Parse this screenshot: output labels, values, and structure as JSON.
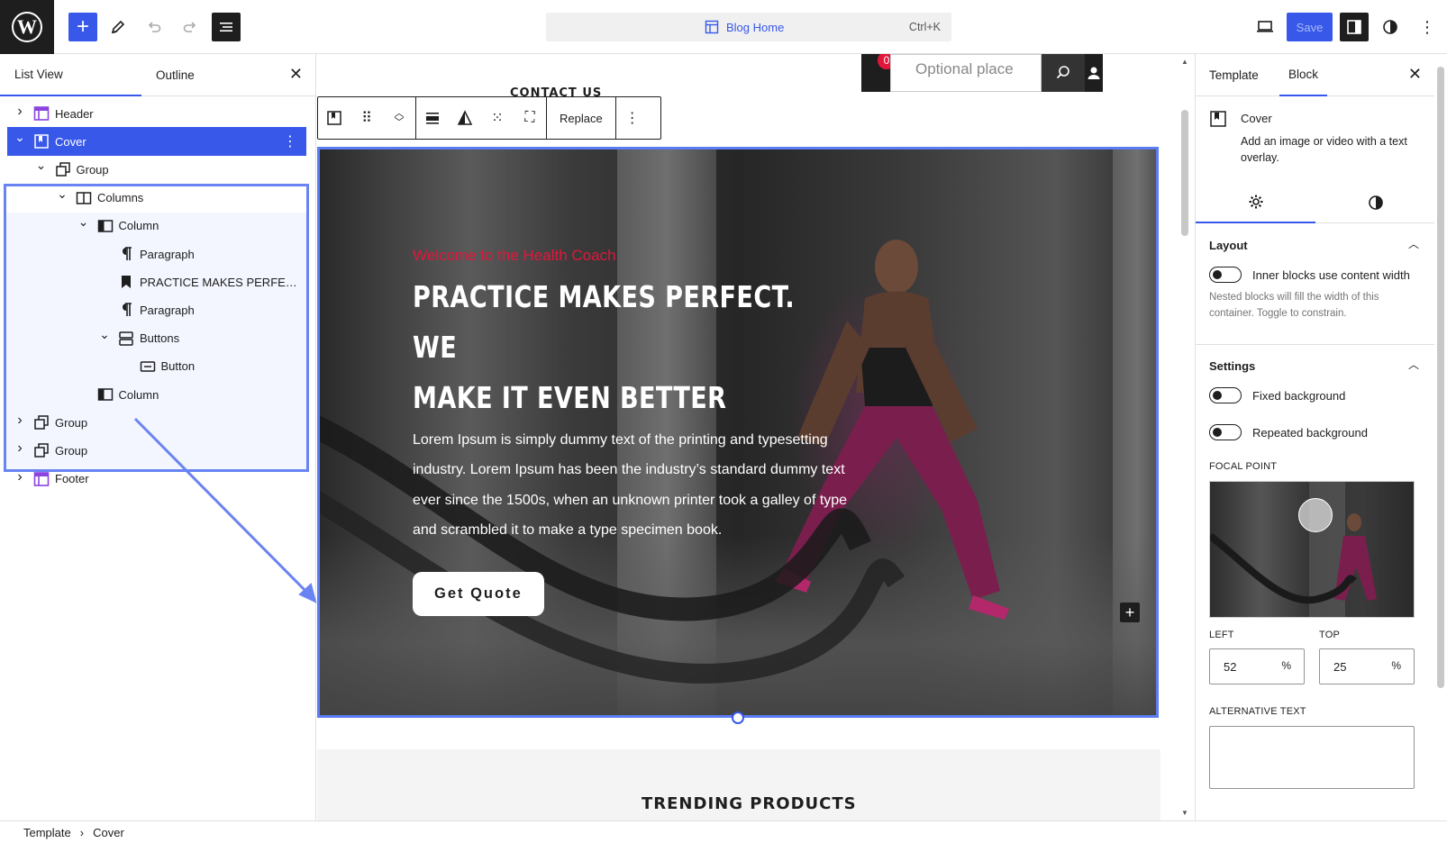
{
  "topbar": {
    "logo": "W",
    "document_title": "Blog Home",
    "shortcut": "Ctrl+K",
    "save_label": "Save",
    "more_icon": "⋮"
  },
  "list_view": {
    "tabs": [
      "List View",
      "Outline"
    ],
    "items": [
      {
        "label": "Header",
        "icon": "template-part-icon",
        "depth": 0,
        "expanded": false
      },
      {
        "label": "Cover",
        "icon": "cover-icon",
        "depth": 0,
        "expanded": true,
        "selected": true
      },
      {
        "label": "Group",
        "icon": "group-icon",
        "depth": 1,
        "expanded": true
      },
      {
        "label": "Columns",
        "icon": "columns-icon",
        "depth": 2,
        "expanded": true
      },
      {
        "label": "Column",
        "icon": "column-icon",
        "depth": 3,
        "expanded": true
      },
      {
        "label": "Paragraph",
        "icon": "paragraph-icon",
        "depth": 4
      },
      {
        "label": "PRACTICE MAKES PERFE…",
        "icon": "heading-bookmark-icon",
        "depth": 4
      },
      {
        "label": "Paragraph",
        "icon": "paragraph-icon",
        "depth": 4
      },
      {
        "label": "Buttons",
        "icon": "buttons-icon",
        "depth": 4,
        "expanded": true
      },
      {
        "label": "Button",
        "icon": "button-icon",
        "depth": 5
      },
      {
        "label": "Column",
        "icon": "column-icon",
        "depth": 3
      },
      {
        "label": "Group",
        "icon": "group-icon",
        "depth": 0,
        "expanded": false
      },
      {
        "label": "Group",
        "icon": "group-icon",
        "depth": 0,
        "expanded": false
      },
      {
        "label": "Footer",
        "icon": "template-part-icon",
        "depth": 0,
        "expanded": false
      }
    ]
  },
  "canvas": {
    "nav_link": "CONTACT US",
    "cart_count": "0",
    "search_placeholder": "Optional place",
    "toolbar_replace": "Replace",
    "cover": {
      "welcome": "Welcome to the Health Coach",
      "headline_line1": "PRACTICE MAKES PERFECT. WE",
      "headline_line2": "MAKE IT EVEN BETTER",
      "body": "Lorem Ipsum is simply dummy text of the printing and typesetting industry. Lorem Ipsum has been the industry’s standard dummy text ever since the 1500s, when an unknown printer took a galley of type and scrambled it to make a type specimen book.",
      "button": "Get Quote"
    },
    "next_section_title": "TRENDING PRODUCTS"
  },
  "settings_panel": {
    "tabs": [
      "Template",
      "Block"
    ],
    "block_name": "Cover",
    "block_description": "Add an image or video with a text overlay.",
    "layout": {
      "title": "Layout",
      "toggle_label": "Inner blocks use content width",
      "help": "Nested blocks will fill the width of this container. Toggle to constrain."
    },
    "settings": {
      "title": "Settings",
      "fixed_bg": "Fixed background",
      "repeated_bg": "Repeated background",
      "focal_point_label": "FOCAL POINT",
      "left_label": "LEFT",
      "top_label": "TOP",
      "left_value": "52",
      "top_value": "25",
      "unit": "%",
      "alt_text_label": "ALTERNATIVE TEXT"
    }
  },
  "breadcrumb": [
    "Template",
    "Cover"
  ],
  "colors": {
    "accent": "#3858e9",
    "selection_outline": "#6a83f2",
    "welcome_text": "#e2163b",
    "dark": "#1e1e1e"
  }
}
